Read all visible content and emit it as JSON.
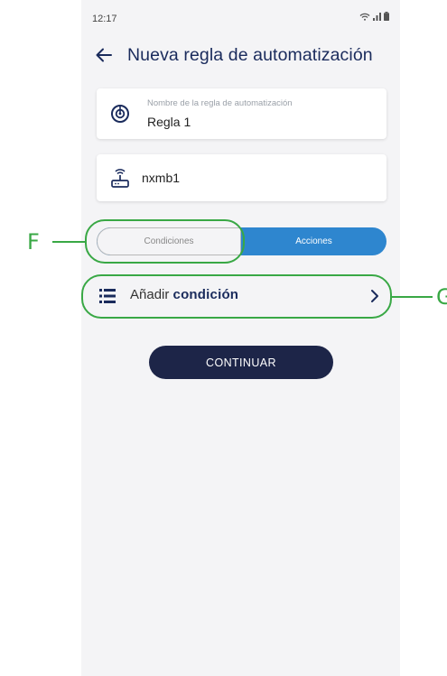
{
  "status_bar": {
    "time": "12:17",
    "icons": [
      "wifi-icon",
      "signal-icon",
      "battery-icon"
    ]
  },
  "header": {
    "title": "Nueva regla de automatización"
  },
  "rule_name_field": {
    "label": "Nombre de la regla de automatización",
    "value": "Regla 1"
  },
  "device": {
    "name": "nxmb1"
  },
  "tabs": {
    "conditions": "Condiciones",
    "actions": "Acciones",
    "selected": "Acciones"
  },
  "add_condition": {
    "prefix": "Añadir",
    "emphasis": "condición"
  },
  "continue_button": {
    "label": "CONTINUAR"
  },
  "annotations": {
    "f": "F",
    "g": "G"
  },
  "colors": {
    "title": "#1a2b5c",
    "active_tab": "#2e86cf",
    "button": "#1d2548",
    "annotation": "#39a845"
  }
}
